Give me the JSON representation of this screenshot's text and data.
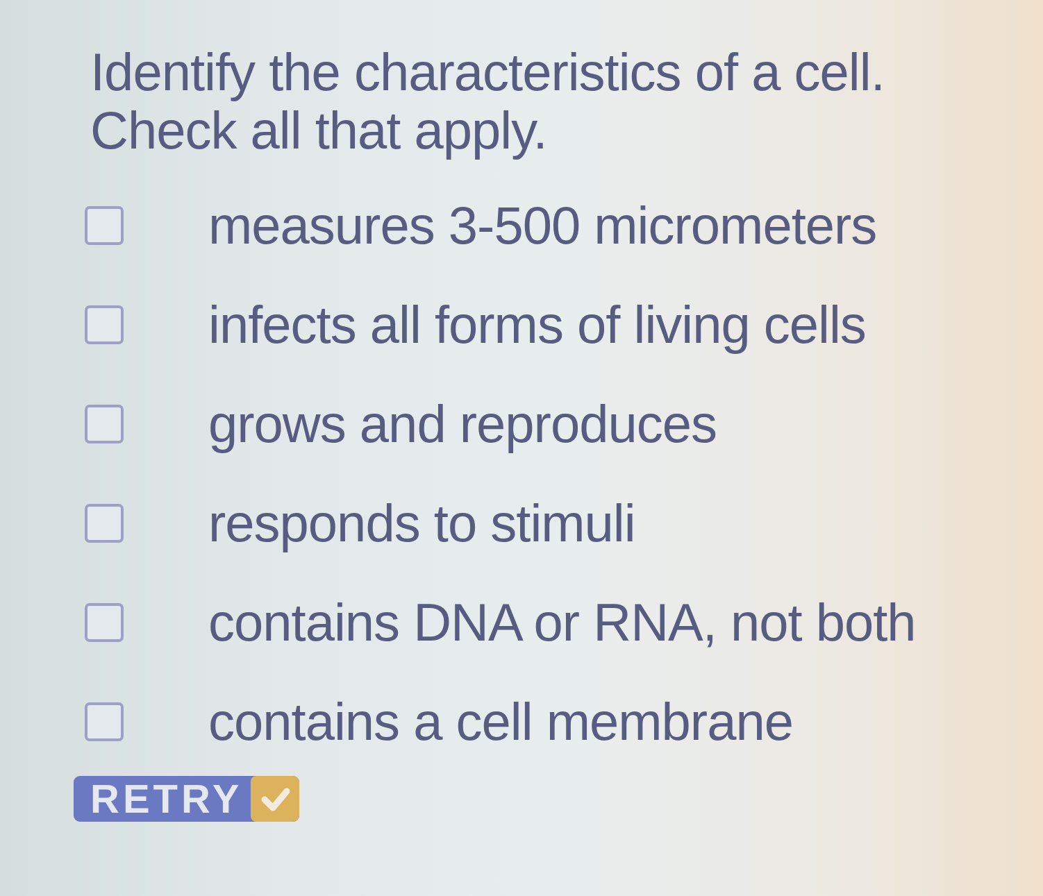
{
  "question": {
    "prompt": "Identify the characteristics of a cell.",
    "instruction": "Check all that apply."
  },
  "options": [
    {
      "label": "measures 3-500 micrometers",
      "checked": false
    },
    {
      "label": "infects all forms of living cells",
      "checked": false
    },
    {
      "label": "grows and reproduces",
      "checked": false
    },
    {
      "label": "responds to stimuli",
      "checked": false
    },
    {
      "label": "contains DNA or RNA, not both",
      "checked": false
    },
    {
      "label": "contains a cell membrane",
      "checked": false
    }
  ],
  "retry_button": {
    "label": "RETRY"
  }
}
